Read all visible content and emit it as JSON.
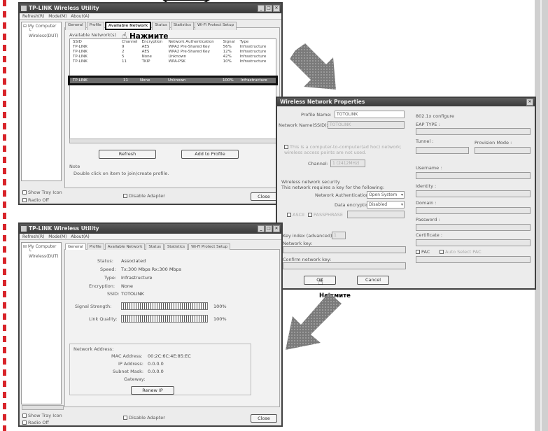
{
  "win1": {
    "title": "TP-LINK Wireless Utility",
    "menu": [
      "Refresh(R)",
      "Mode(M)",
      "About(A)"
    ],
    "tree": [
      "My Computer",
      "Wireless(DUT)"
    ],
    "tabs": [
      "General",
      "Profile",
      "Available Network",
      "Status",
      "Statistics",
      "Wi-Fi Protect Setup"
    ],
    "section_label": "Available Network(s)",
    "columns": [
      "SSID",
      "Channel",
      "Encryption",
      "Network Authentication",
      "Signal",
      "Type"
    ],
    "rows": [
      [
        "TP-LINK",
        "9",
        "AES",
        "WPA2 Pre-Shared Key",
        "56%",
        "Infrastructure"
      ],
      [
        "TP-LINK",
        "2",
        "AES",
        "WPA2 Pre-Shared Key",
        "12%",
        "Infrastructure"
      ],
      [
        "TP-LINK",
        "5",
        "None",
        "Unknown",
        "42%",
        "Infrastructure"
      ],
      [
        "TP-LINK",
        "11",
        "TKIP",
        "WPA-PSK",
        "10%",
        "Infrastructure"
      ]
    ],
    "selected_row": [
      "TP-LINK",
      "11",
      "None",
      "Unknown",
      "100%",
      "Infrastructure"
    ],
    "refresh": "Refresh",
    "add_to_profile": "Add to Profile",
    "note_title": "Note",
    "note_text": "Double click on item to join/create profile.",
    "show_tray": "Show Tray Icon",
    "radio_off": "Radio Off",
    "disable_adapter": "Disable Adapter",
    "close": "Close"
  },
  "callout1": "Нажмите",
  "dialog": {
    "title": "Wireless Network Properties",
    "profile_name_label": "Profile Name:",
    "profile_name_value": "TOTOLINK",
    "ssid_label": "Network Name(SSID):",
    "ssid_value": "TOTOLINK",
    "adhoc_text": "This is a computer-to-computer(ad hoc) network; wireless access points are not used.",
    "channel_label": "Channel:",
    "channel_value": "1 (2412MHz)",
    "security_title": "Wireless network security",
    "security_desc": "This network requires a key for the following:",
    "auth_label": "Network Authentication:",
    "auth_value": "Open System",
    "encryption_label": "Data encryption:",
    "encryption_value": "Disabled",
    "ascii_label": "ASCII",
    "passphrase_label": "PASSPHRASE",
    "key_index_label": "Key index (advanced):",
    "key_index_value": "1",
    "network_key_label": "Network key:",
    "confirm_key_label": "Confirm network key:",
    "ok": "OK",
    "cancel": "Cancel",
    "eap": {
      "title": "802.1x configure",
      "eap_type": "EAP TYPE :",
      "tunnel": "Tunnel :",
      "provision": "Provision Mode :",
      "username": "Username :",
      "identity": "Identity :",
      "domain": "Domain :",
      "password": "Password :",
      "certificate": "Certificate :",
      "pac": "PAC",
      "auto_select": "Auto Select PAC"
    }
  },
  "callout2": "Нажмите",
  "win2": {
    "title": "TP-LINK Wireless Utility",
    "menu": [
      "Refresh(R)",
      "Mode(M)",
      "About(A)"
    ],
    "tree": [
      "My Computer",
      "Wireless(DUT)"
    ],
    "tabs": [
      "General",
      "Profile",
      "Available Network",
      "Status",
      "Statistics",
      "Wi-Fi Protect Setup"
    ],
    "status_label": "Status:",
    "status_value": "Associated",
    "speed_label": "Speed:",
    "speed_value": "Tx:300 Mbps Rx:300 Mbps",
    "type_label": "Type:",
    "type_value": "Infrastructure",
    "encryption_label": "Encryption:",
    "encryption_value": "None",
    "ssid_label": "SSID:",
    "ssid_value": "TOTOLINK",
    "signal_label": "Signal Strength:",
    "signal_value": "100%",
    "signal_pct": 100,
    "link_label": "Link Quality:",
    "link_value": "100%",
    "link_pct": 100,
    "net_addr_title": "Network Address:",
    "mac_label": "MAC Address:",
    "mac_value": "00:2C:6C:4E:85:EC",
    "ip_label": "IP Address:",
    "ip_value": "0.0.0.0",
    "subnet_label": "Subnet Mask:",
    "subnet_value": "0.0.0.0",
    "gateway_label": "Gateway:",
    "gateway_value": "",
    "renew": "Renew IP",
    "show_tray": "Show Tray Icon",
    "radio_off": "Radio Off",
    "disable_adapter": "Disable Adapter",
    "close": "Close"
  }
}
